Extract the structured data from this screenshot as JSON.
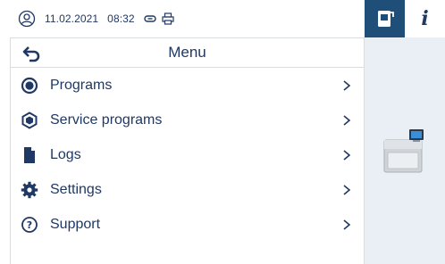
{
  "status": {
    "date": "11.02.2021",
    "time": "08:32",
    "icons": [
      "user-circle-icon",
      "link-icon",
      "printer-icon"
    ]
  },
  "menu": {
    "title": "Menu",
    "back_icon": "back-arrow-icon",
    "items": [
      {
        "label": "Programs",
        "icon": "record-circle-icon"
      },
      {
        "label": "Service programs",
        "icon": "hexagon-icon"
      },
      {
        "label": "Logs",
        "icon": "document-icon"
      },
      {
        "label": "Settings",
        "icon": "gear-icon"
      },
      {
        "label": "Support",
        "icon": "question-circle-icon"
      }
    ]
  },
  "side": {
    "tabs": [
      {
        "name": "device-tab",
        "icon": "device-icon",
        "active": true
      },
      {
        "name": "info-tab",
        "icon": "info-icon",
        "label": "i",
        "active": false
      }
    ],
    "device_image": "autoclave-device-image"
  },
  "colors": {
    "primary": "#1f3864",
    "accent": "#1f4e79",
    "side_bg": "#e9eff4",
    "divider": "#d5dde5"
  }
}
